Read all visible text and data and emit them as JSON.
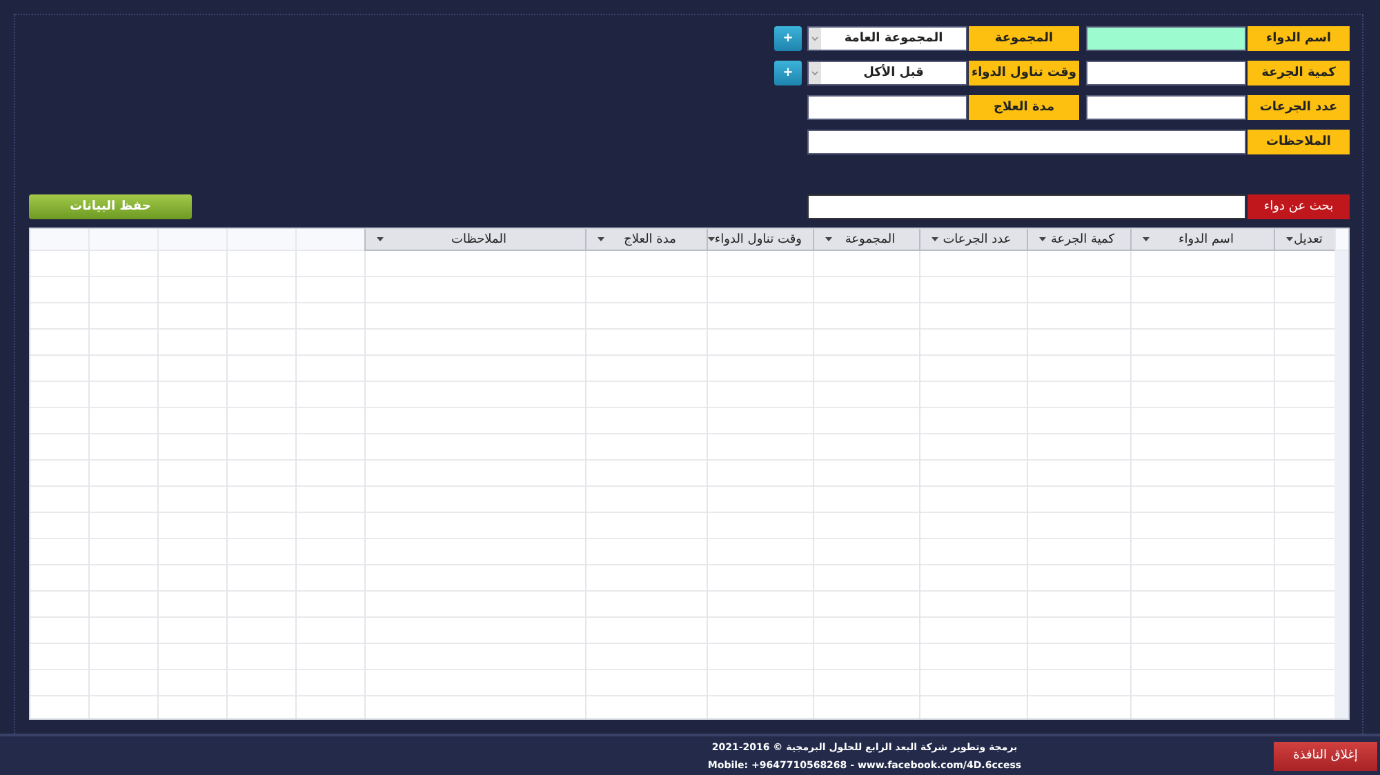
{
  "form": {
    "rows": [
      [
        {
          "label": "اسم الدواء",
          "kind": "text",
          "highlighted": true
        },
        {
          "label": "المجموعة",
          "kind": "select",
          "value": "المجموعة العامة",
          "add_button": "+"
        }
      ],
      [
        {
          "label": "كمية الجرعة",
          "kind": "text",
          "highlighted": false
        },
        {
          "label": "وقت تناول الدواء",
          "kind": "select",
          "value": "قبل الأكل",
          "add_button": "+"
        }
      ],
      [
        {
          "label": "عدد الجرعات",
          "kind": "text",
          "highlighted": false
        },
        {
          "label": "مدة العلاج",
          "kind": "text",
          "highlighted": false
        }
      ],
      [
        {
          "label": "الملاحظات",
          "kind": "wide",
          "highlighted": false
        }
      ]
    ]
  },
  "save_button": "حفظ البيانات",
  "search": {
    "button": "بحث عن دواء"
  },
  "table": {
    "columns": [
      "تعديل",
      "اسم الدواء",
      "كمية الجرعة",
      "عدد الجرعات",
      "المجموعة",
      "وقت تناول الدواء",
      "مدة العلاج",
      "الملاحظات"
    ]
  },
  "footer": {
    "lines": [
      "برمجة وتطوير شركة البعد الرابع للحلول البرمجية © 2016-2021",
      "Mobile: +9647710568268 - www.facebook.com/4D.6ccess"
    ],
    "close_button": "إغلاق النافذة"
  }
}
